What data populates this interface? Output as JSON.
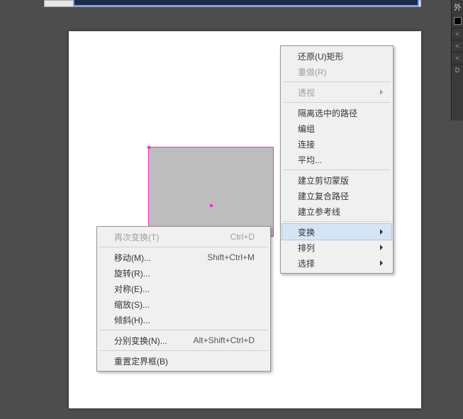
{
  "right_panel": {
    "label": "外",
    "marks": [
      "<",
      "<",
      "<",
      "D"
    ]
  },
  "primary_menu": {
    "groups": [
      [
        {
          "label": "还原(U)矩形",
          "name": "undo",
          "disabled": false,
          "sub": false
        },
        {
          "label": "重做(R)",
          "name": "redo",
          "disabled": true,
          "sub": false
        }
      ],
      [
        {
          "label": "透视",
          "name": "perspective",
          "disabled": true,
          "sub": true
        }
      ],
      [
        {
          "label": "隔离选中的路径",
          "name": "isolate-path",
          "disabled": false,
          "sub": false
        },
        {
          "label": "编组",
          "name": "group",
          "disabled": false,
          "sub": false
        },
        {
          "label": "连接",
          "name": "join",
          "disabled": false,
          "sub": false
        },
        {
          "label": "平均...",
          "name": "average",
          "disabled": false,
          "sub": false
        }
      ],
      [
        {
          "label": "建立剪切蒙版",
          "name": "make-clipping-mask",
          "disabled": false,
          "sub": false
        },
        {
          "label": "建立复合路径",
          "name": "make-compound-path",
          "disabled": false,
          "sub": false
        },
        {
          "label": "建立参考线",
          "name": "make-guides",
          "disabled": false,
          "sub": false
        }
      ],
      [
        {
          "label": "变换",
          "name": "transform",
          "disabled": false,
          "sub": true,
          "highlight": true
        },
        {
          "label": "排列",
          "name": "arrange",
          "disabled": false,
          "sub": true
        },
        {
          "label": "选择",
          "name": "select",
          "disabled": false,
          "sub": true
        }
      ]
    ]
  },
  "secondary_menu": {
    "groups": [
      [
        {
          "label": "再次变换(T)",
          "shortcut": "Ctrl+D",
          "name": "transform-again",
          "disabled": true
        }
      ],
      [
        {
          "label": "移动(M)...",
          "shortcut": "Shift+Ctrl+M",
          "name": "move",
          "disabled": false
        },
        {
          "label": "旋转(R)...",
          "shortcut": "",
          "name": "rotate",
          "disabled": false
        },
        {
          "label": "对称(E)...",
          "shortcut": "",
          "name": "reflect",
          "disabled": false
        },
        {
          "label": "缩放(S)...",
          "shortcut": "",
          "name": "scale",
          "disabled": false
        },
        {
          "label": "倾斜(H)...",
          "shortcut": "",
          "name": "shear",
          "disabled": false
        }
      ],
      [
        {
          "label": "分别变换(N)...",
          "shortcut": "Alt+Shift+Ctrl+D",
          "name": "transform-each",
          "disabled": false
        }
      ],
      [
        {
          "label": "重置定界框(B)",
          "shortcut": "",
          "name": "reset-bounding-box",
          "disabled": false
        }
      ]
    ]
  }
}
